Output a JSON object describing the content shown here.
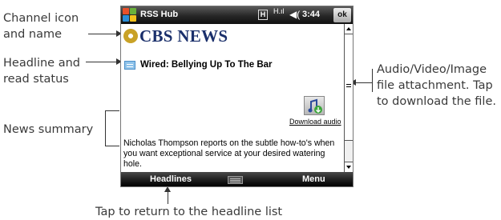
{
  "callouts": {
    "channel": "Channel icon\nand name",
    "headline": "Headline and\nread status",
    "summary": "News summary",
    "attachment": "Audio/Video/Image\nfile attachment. Tap\nto download the file.",
    "headlines_softkey": "Tap to return to the headline list"
  },
  "titlebar": {
    "app_title": "RSS Hub",
    "network_indicator": "H",
    "signal_glyph": "H.ıl",
    "volume_glyph": "◀(",
    "time": "3:44",
    "ok_label": "ok"
  },
  "content": {
    "channel_name": "CBS NEWS",
    "headline": "Wired: Bellying Up To The Bar",
    "download_label": "Download audio",
    "summary": "Nicholas Thompson reports on the subtle how-to's when you want exceptional service at your desired watering hole."
  },
  "menubar": {
    "left_softkey": "Headlines",
    "right_softkey": "Menu"
  },
  "icons": {
    "windows_logo": "windows-start-icon",
    "channel_icon": "cbs-eye-icon",
    "read_status": "read-status-icon",
    "attachment": "audio-attachment-icon",
    "keyboard": "keyboard-icon"
  },
  "colors": {
    "channel_name": "#1a2f6b",
    "titlebar": "#262626",
    "menubar": "#1a1a1a"
  }
}
